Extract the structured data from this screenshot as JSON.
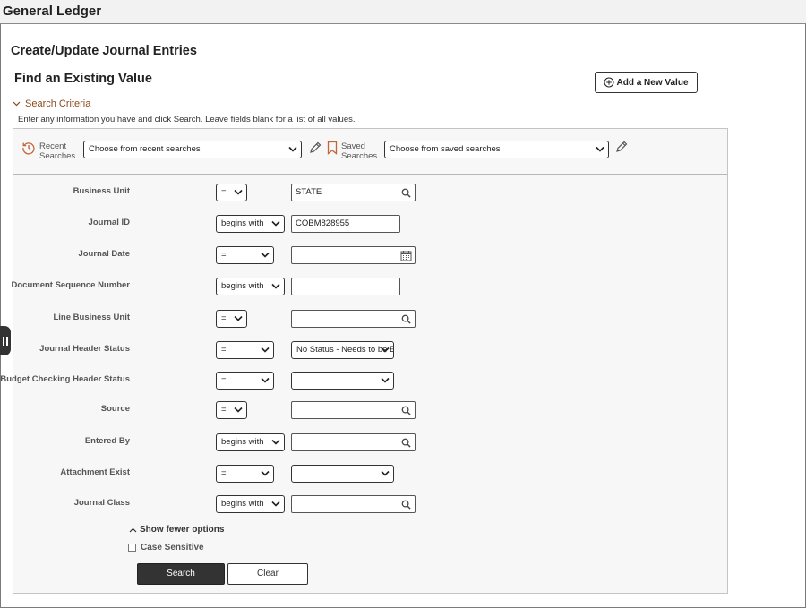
{
  "app": {
    "title": "General Ledger"
  },
  "page": {
    "title": "Create/Update Journal Entries",
    "section": "Find an Existing Value"
  },
  "add_button": {
    "label": "Add a New Value",
    "icon": "plus-circle-icon"
  },
  "search_criteria": {
    "toggle_label": "Search Criteria",
    "instructions": "Enter any information you have and click Search. Leave fields blank for a list of all values."
  },
  "recent": {
    "label_line1": "Recent",
    "label_line2": "Searches",
    "select_value": "Choose from recent searches",
    "icon": "history-icon"
  },
  "saved": {
    "label_line1": "Saved",
    "label_line2": "Searches",
    "select_value": "Choose from saved searches",
    "icon": "bookmark-icon"
  },
  "fields": [
    {
      "label": "Business Unit",
      "operator": "=",
      "value": "STATE",
      "control": "lookup"
    },
    {
      "label": "Journal ID",
      "operator": "begins with",
      "value": "COBM828955",
      "control": "text"
    },
    {
      "label": "Journal Date",
      "operator": "=",
      "value": "",
      "control": "date"
    },
    {
      "label": "Document Sequence Number",
      "operator": "begins with",
      "value": "",
      "control": "text"
    },
    {
      "label": "Line Business Unit",
      "operator": "=",
      "value": "",
      "control": "lookup"
    },
    {
      "label": "Journal Header Status",
      "operator": "=",
      "value": "No Status - Needs to be Edited",
      "control": "select"
    },
    {
      "label": "Budget Checking Header Status",
      "operator": "=",
      "value": "",
      "control": "select"
    },
    {
      "label": "Source",
      "operator": "=",
      "value": "",
      "control": "lookup"
    },
    {
      "label": "Entered By",
      "operator": "begins with",
      "value": "",
      "control": "lookup"
    },
    {
      "label": "Attachment Exist",
      "operator": "=",
      "value": "",
      "control": "select"
    },
    {
      "label": "Journal Class",
      "operator": "begins with",
      "value": "",
      "control": "lookup"
    }
  ],
  "options": {
    "show_fewer_label": "Show fewer options",
    "case_sensitive_label": "Case Sensitive",
    "case_sensitive_checked": false
  },
  "buttons": {
    "search": "Search",
    "clear": "Clear"
  },
  "colors": {
    "accent": "#8a4a1c",
    "primary_button": "#333333",
    "header_bg": "#f2f2f2",
    "panel_bg": "#f7f7f7"
  }
}
